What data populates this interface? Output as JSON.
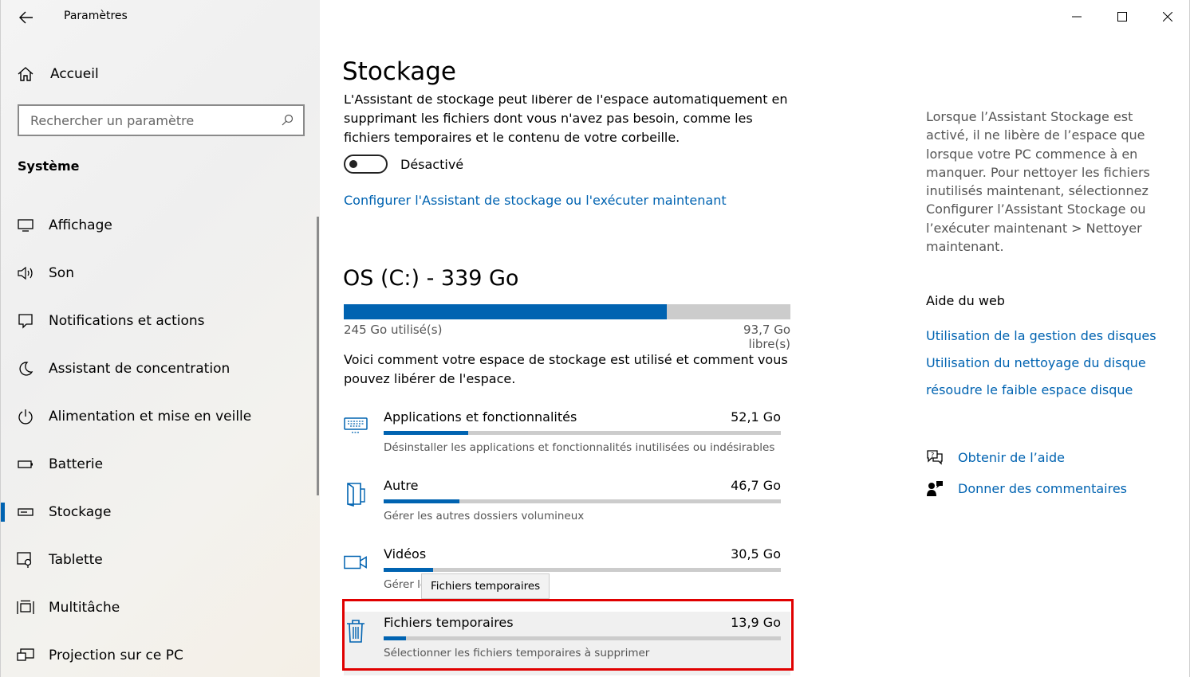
{
  "window": {
    "title": "Paramètres"
  },
  "sidebar": {
    "home_label": "Accueil",
    "search_placeholder": "Rechercher un paramètre",
    "section": "Système",
    "items": [
      {
        "label": "Affichage",
        "icon": "display-icon"
      },
      {
        "label": "Son",
        "icon": "speaker-icon"
      },
      {
        "label": "Notifications et actions",
        "icon": "notification-icon"
      },
      {
        "label": "Assistant de concentration",
        "icon": "moon-icon"
      },
      {
        "label": "Alimentation et mise en veille",
        "icon": "power-icon"
      },
      {
        "label": "Batterie",
        "icon": "battery-icon"
      },
      {
        "label": "Stockage",
        "icon": "storage-icon",
        "active": true
      },
      {
        "label": "Tablette",
        "icon": "tablet-icon"
      },
      {
        "label": "Multitâche",
        "icon": "multitask-icon"
      },
      {
        "label": "Projection sur ce PC",
        "icon": "projection-icon"
      }
    ]
  },
  "main": {
    "title": "Stockage",
    "intro": "L'Assistant de stockage peut libérer de l'espace automatiquement en supprimant les fichiers dont vous n'avez pas besoin, comme les fichiers temporaires et le contenu de votre corbeille.",
    "toggle_state": "Désactivé",
    "configure_link": "Configurer l'Assistant de stockage ou l'exécuter maintenant",
    "drive": {
      "title": "OS (C:) - 339 Go",
      "used_fraction": 0.723,
      "used_text": "245 Go utilisé(s)",
      "free_text": "93,7 Go libre(s)"
    },
    "explain": "Voici comment votre espace de stockage est utilisé et comment vous pouvez libérer de l'espace.",
    "categories": [
      {
        "name": "Applications et fonctionnalités",
        "size": "52,1 Go",
        "fraction": 0.212,
        "desc": "Désinstaller les applications et fonctionnalités inutilisées ou indésirables",
        "icon": "apps-icon"
      },
      {
        "name": "Autre",
        "size": "46,7 Go",
        "fraction": 0.19,
        "desc": "Gérer les autres dossiers volumineux",
        "icon": "folder-icon"
      },
      {
        "name": "Vidéos",
        "size": "30,5 Go",
        "fraction": 0.124,
        "desc": "Gérer le",
        "icon": "video-icon"
      },
      {
        "name": "Fichiers temporaires",
        "size": "13,9 Go",
        "fraction": 0.056,
        "desc": "Sélectionner les fichiers temporaires à supprimer",
        "icon": "trash-icon"
      }
    ],
    "tooltip": "Fichiers temporaires"
  },
  "right": {
    "description": "Lorsque l’Assistant Stockage est activé, il ne libère de l’espace que lorsque votre PC commence à en manquer. Pour nettoyer les fichiers inutilisés maintenant, sélectionnez Configurer l’Assistant Stockage ou l’exécuter maintenant > Nettoyer maintenant.",
    "web_help_title": "Aide du web",
    "web_links": [
      "Utilisation de la gestion des disques",
      "Utilisation du nettoyage du disque",
      "résoudre le faible espace disque"
    ],
    "get_help": "Obtenir de l’aide",
    "feedback": "Donner des commentaires"
  },
  "colors": {
    "accent": "#0063b1",
    "highlight_border": "#e00000"
  }
}
